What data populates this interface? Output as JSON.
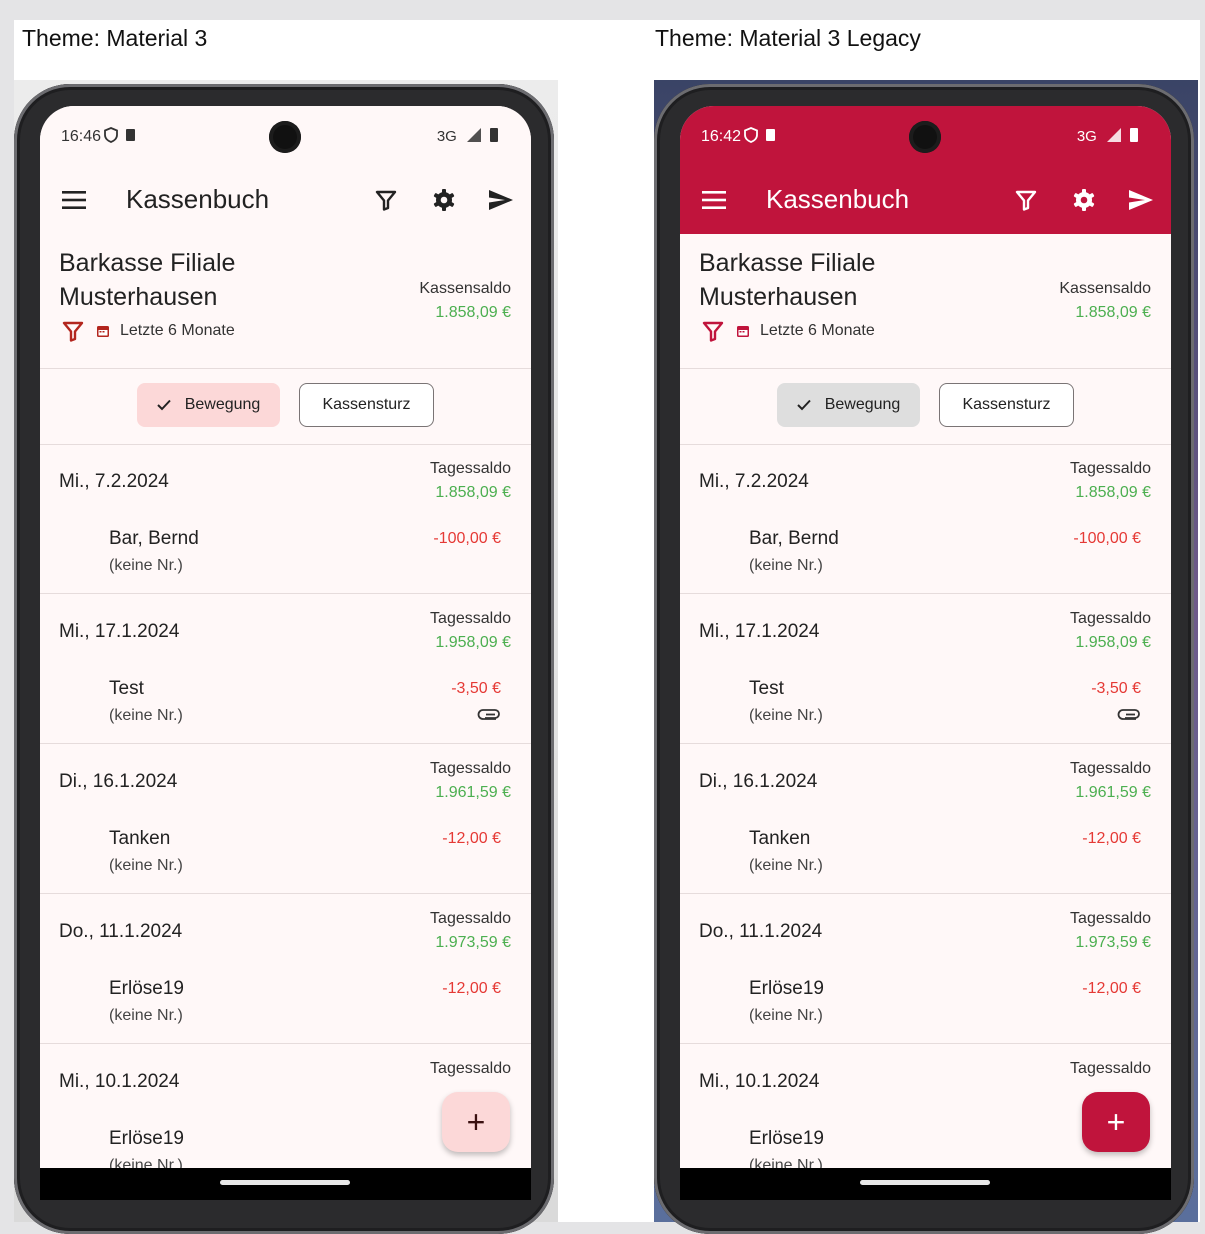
{
  "themes": [
    {
      "label": "Theme: Material 3",
      "status": {
        "time": "16:46",
        "network": "3G"
      },
      "app_title": "Kassenbuch",
      "branch": "Barkasse Filiale Musterhausen",
      "saldo_label": "Kassensaldo",
      "saldo_value": "1.858,09 €",
      "period": "Letzte 6 Monate",
      "segments": {
        "selected": "Bewegung",
        "other": "Kassensturz"
      },
      "days": [
        {
          "date": "Mi., 7.2.2024",
          "ts_label": "Tagessaldo",
          "ts_value": "1.858,09 €",
          "tx_name": "Bar, Bernd",
          "tx_nr": "(keine Nr.)",
          "amount": "-100,00 €"
        },
        {
          "date": "Mi., 17.1.2024",
          "ts_label": "Tagessaldo",
          "ts_value": "1.958,09 €",
          "tx_name": "Test",
          "tx_nr": "(keine Nr.)",
          "amount": "-3,50 €",
          "attachment_icon": "paperclip-icon"
        },
        {
          "date": "Di., 16.1.2024",
          "ts_label": "Tagessaldo",
          "ts_value": "1.961,59 €",
          "tx_name": "Tanken",
          "tx_nr": "(keine Nr.)",
          "amount": "-12,00 €"
        },
        {
          "date": "Do., 11.1.2024",
          "ts_label": "Tagessaldo",
          "ts_value": "1.973,59 €",
          "tx_name": "Erlöse19",
          "tx_nr": "(keine Nr.)",
          "amount": "-12,00 €"
        },
        {
          "date": "Mi., 10.1.2024",
          "ts_label": "Tagessaldo",
          "tx_name": "Erlöse19",
          "tx_nr": "(keine Nr.)"
        }
      ],
      "fab_label": "+",
      "colors": {
        "appbar_bg": "#fff8f8",
        "appbar_fg": "#222222",
        "status_fg": "#333333",
        "accent": "#b3261e",
        "segment_selected_bg": "#fcd8d8",
        "fab_bg": "#fcd8d8",
        "fab_fg": "#3a1010"
      }
    },
    {
      "label": "Theme: Material 3 Legacy",
      "status": {
        "time": "16:42",
        "network": "3G"
      },
      "app_title": "Kassenbuch",
      "branch": "Barkasse Filiale Musterhausen",
      "saldo_label": "Kassensaldo",
      "saldo_value": "1.858,09 €",
      "period": "Letzte 6 Monate",
      "segments": {
        "selected": "Bewegung",
        "other": "Kassensturz"
      },
      "days": [
        {
          "date": "Mi., 7.2.2024",
          "ts_label": "Tagessaldo",
          "ts_value": "1.858,09 €",
          "tx_name": "Bar, Bernd",
          "tx_nr": "(keine Nr.)",
          "amount": "-100,00 €"
        },
        {
          "date": "Mi., 17.1.2024",
          "ts_label": "Tagessaldo",
          "ts_value": "1.958,09 €",
          "tx_name": "Test",
          "tx_nr": "(keine Nr.)",
          "amount": "-3,50 €",
          "attachment_icon": "paperclip-icon"
        },
        {
          "date": "Di., 16.1.2024",
          "ts_label": "Tagessaldo",
          "ts_value": "1.961,59 €",
          "tx_name": "Tanken",
          "tx_nr": "(keine Nr.)",
          "amount": "-12,00 €"
        },
        {
          "date": "Do., 11.1.2024",
          "ts_label": "Tagessaldo",
          "ts_value": "1.973,59 €",
          "tx_name": "Erlöse19",
          "tx_nr": "(keine Nr.)",
          "amount": "-12,00 €"
        },
        {
          "date": "Mi., 10.1.2024",
          "ts_label": "Tagessaldo",
          "tx_name": "Erlöse19",
          "tx_nr": "(keine Nr.)"
        }
      ],
      "fab_label": "+",
      "colors": {
        "appbar_bg": "#c0143c",
        "appbar_fg": "#ffffff",
        "status_fg": "#ffffff",
        "accent": "#c0143c",
        "segment_selected_bg": "#dedede",
        "fab_bg": "#c0143c",
        "fab_fg": "#ffffff"
      }
    }
  ]
}
